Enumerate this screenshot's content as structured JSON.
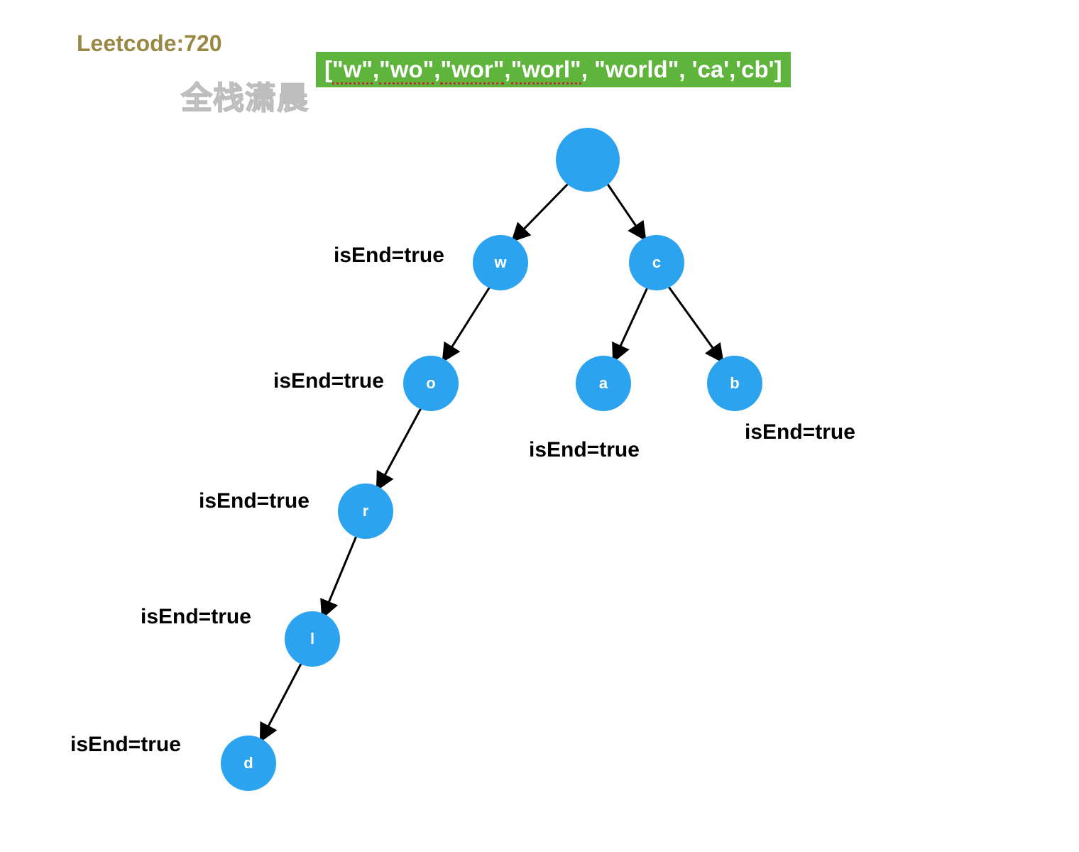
{
  "title": "Leetcode:720",
  "watermark": "全栈潇晨",
  "banner": {
    "prefix": "[",
    "items": [
      "\"w\"",
      "\"wo\"",
      "\"wor\"",
      "\"worl\"",
      "\"world\"",
      "'ca'",
      "'cb'"
    ],
    "suffix": "]"
  },
  "nodes": {
    "root": "",
    "w": "w",
    "o": "o",
    "r": "r",
    "l": "l",
    "d": "d",
    "c": "c",
    "a": "a",
    "b": "b"
  },
  "labels": {
    "w": "isEnd=true",
    "o": "isEnd=true",
    "r": "isEnd=true",
    "l": "isEnd=true",
    "d": "isEnd=true",
    "a": "isEnd=true",
    "b": "isEnd=true"
  }
}
